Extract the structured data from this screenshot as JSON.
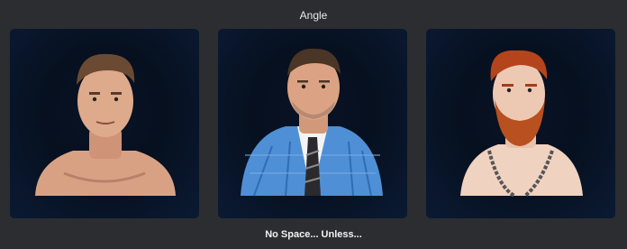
{
  "header": {
    "title": "Angle"
  },
  "cards": [
    {
      "id": "wrestler-1",
      "description": "short brown hair, bare chest"
    },
    {
      "id": "wrestler-2",
      "description": "blue plaid suit, white shirt, striped tie"
    },
    {
      "id": "wrestler-3",
      "description": "red hair and beard, chain necklace"
    }
  ],
  "footer": {
    "caption": "No Space... Unless..."
  }
}
